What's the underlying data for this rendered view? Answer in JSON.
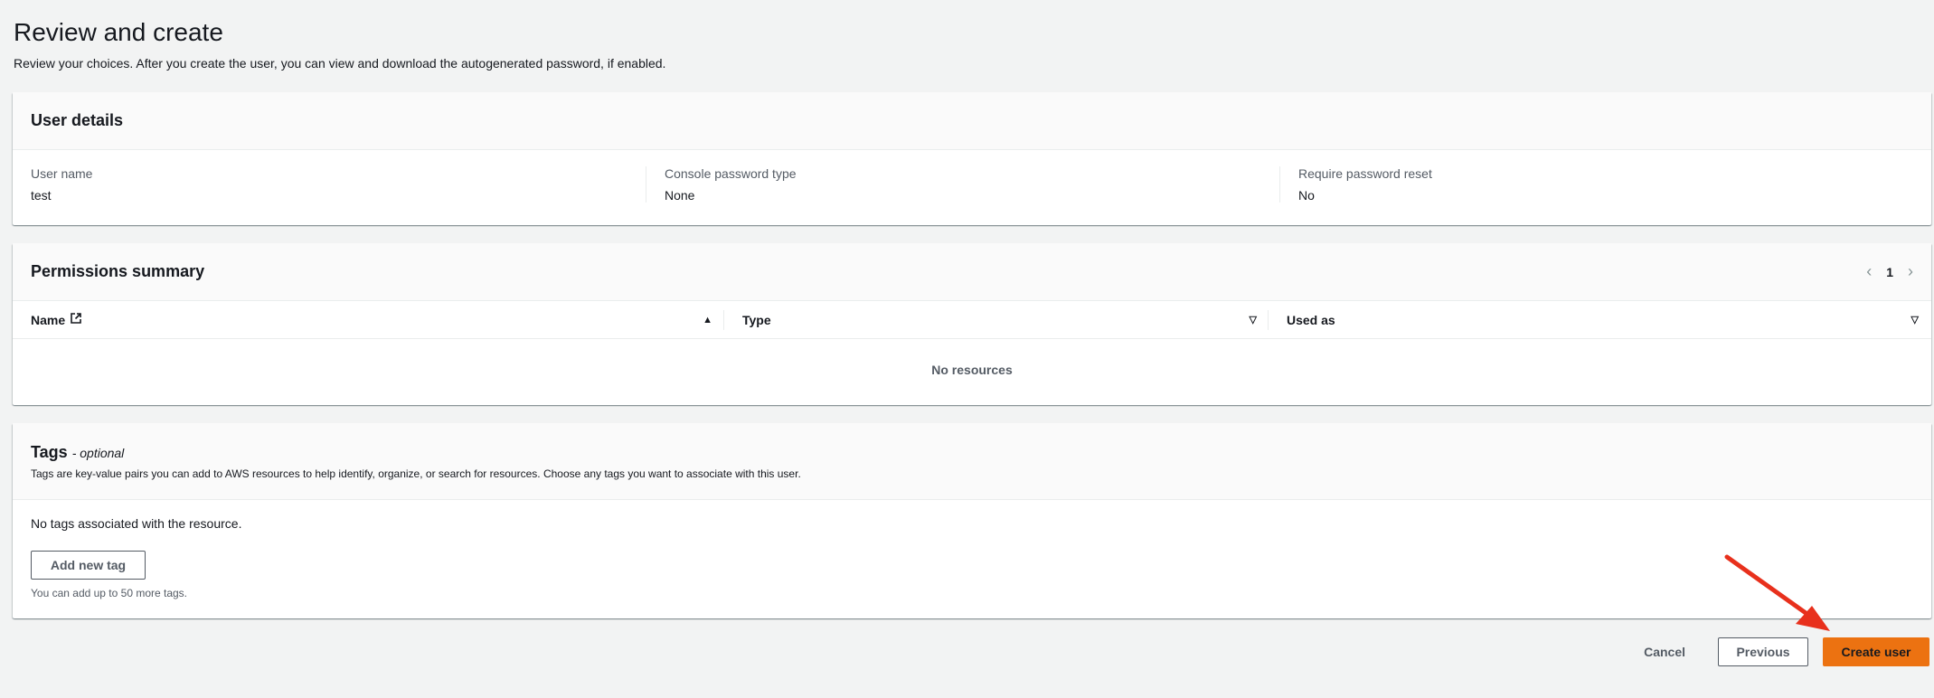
{
  "header": {
    "title": "Review and create",
    "description": "Review your choices. After you create the user, you can view and download the autogenerated password, if enabled."
  },
  "user_details": {
    "title": "User details",
    "fields": [
      {
        "label": "User name",
        "value": "test"
      },
      {
        "label": "Console password type",
        "value": "None"
      },
      {
        "label": "Require password reset",
        "value": "No"
      }
    ]
  },
  "permissions": {
    "title": "Permissions summary",
    "page": "1",
    "columns": [
      "Name",
      "Type",
      "Used as"
    ],
    "empty_text": "No resources"
  },
  "tags": {
    "title": "Tags",
    "optional": "- optional",
    "description": "Tags are key-value pairs you can add to AWS resources to help identify, organize, or search for resources. Choose any tags you want to associate with this user.",
    "empty_text": "No tags associated with the resource.",
    "add_button": "Add new tag",
    "hint": "You can add up to 50 more tags."
  },
  "actions": {
    "cancel": "Cancel",
    "previous": "Previous",
    "create": "Create user"
  },
  "colors": {
    "primary": "#ec7211",
    "annotation_arrow": "#e8301c"
  }
}
